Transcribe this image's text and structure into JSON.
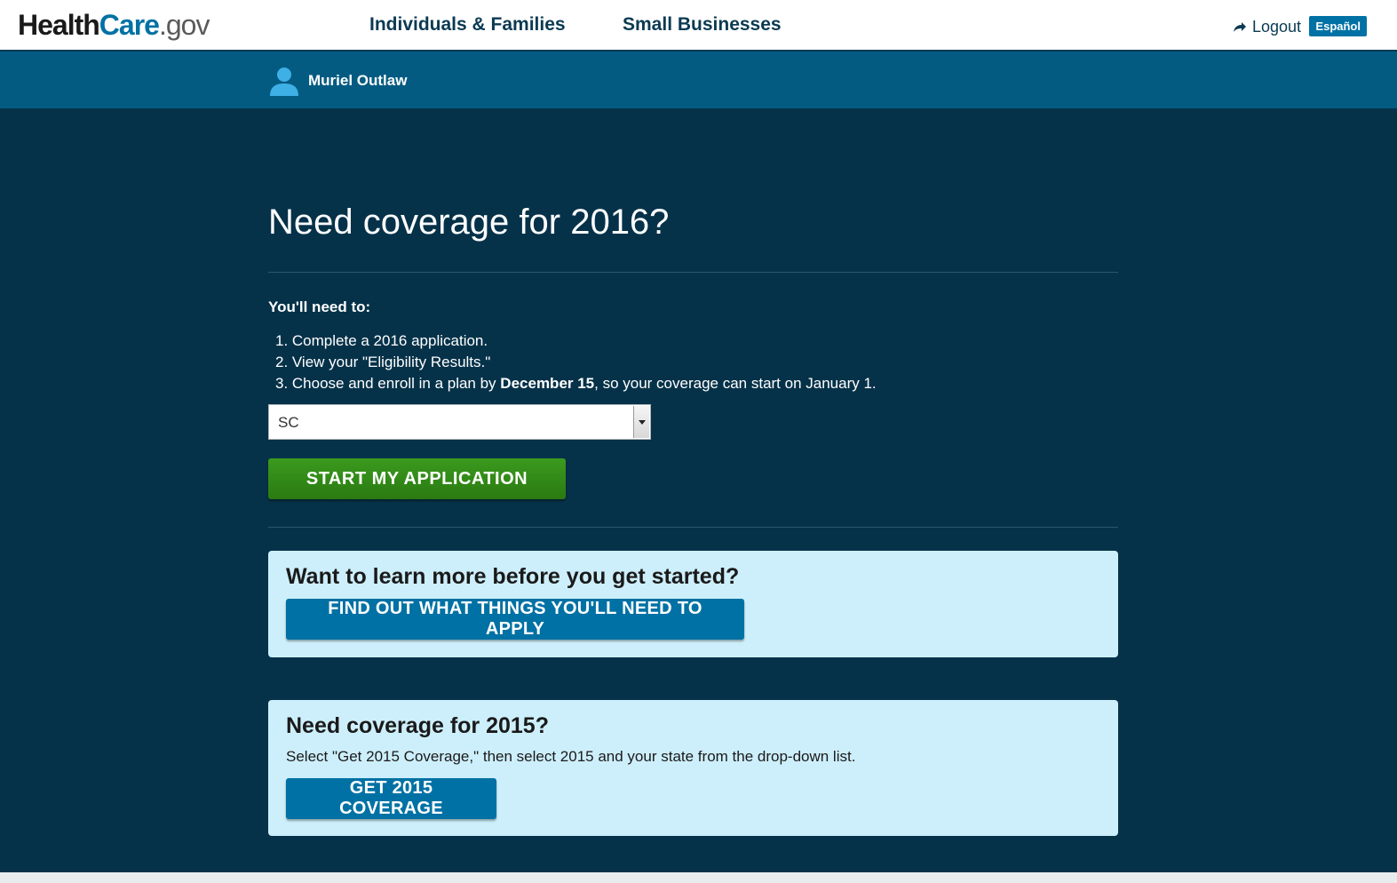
{
  "header": {
    "logo": {
      "health": "Health",
      "care": "Care",
      "gov": ".gov"
    },
    "nav": [
      {
        "label": "Individuals & Families"
      },
      {
        "label": "Small Businesses"
      }
    ],
    "logout_label": "Logout",
    "language_label": "Español"
  },
  "userbar": {
    "user_name": "Muriel Outlaw"
  },
  "main": {
    "title": "Need coverage for 2016?",
    "need_heading": "You'll need to:",
    "steps": [
      "1. Complete a 2016 application.",
      "2. View your \"Eligibility Results.\""
    ],
    "step3": {
      "prefix": "3. Choose and enroll in a plan by ",
      "bold": "December 15",
      "suffix": ", so your coverage can start on January 1."
    },
    "state_select": {
      "value": "SC"
    },
    "start_button": "START MY APPLICATION"
  },
  "learn_card": {
    "heading": "Want to learn more before you get started?",
    "button": "FIND OUT WHAT THINGS YOU'LL NEED TO APPLY"
  },
  "coverage_2015_card": {
    "heading": "Need coverage for 2015?",
    "text": "Select \"Get 2015 Coverage,\" then select 2015 and your state from the drop-down list.",
    "button": "GET 2015 COVERAGE"
  },
  "colors": {
    "brand_blue": "#0071a4",
    "header_dark": "#063249",
    "userbar": "#045b82",
    "start_green": "#2a7a11",
    "card_bg": "#cdeffb"
  }
}
